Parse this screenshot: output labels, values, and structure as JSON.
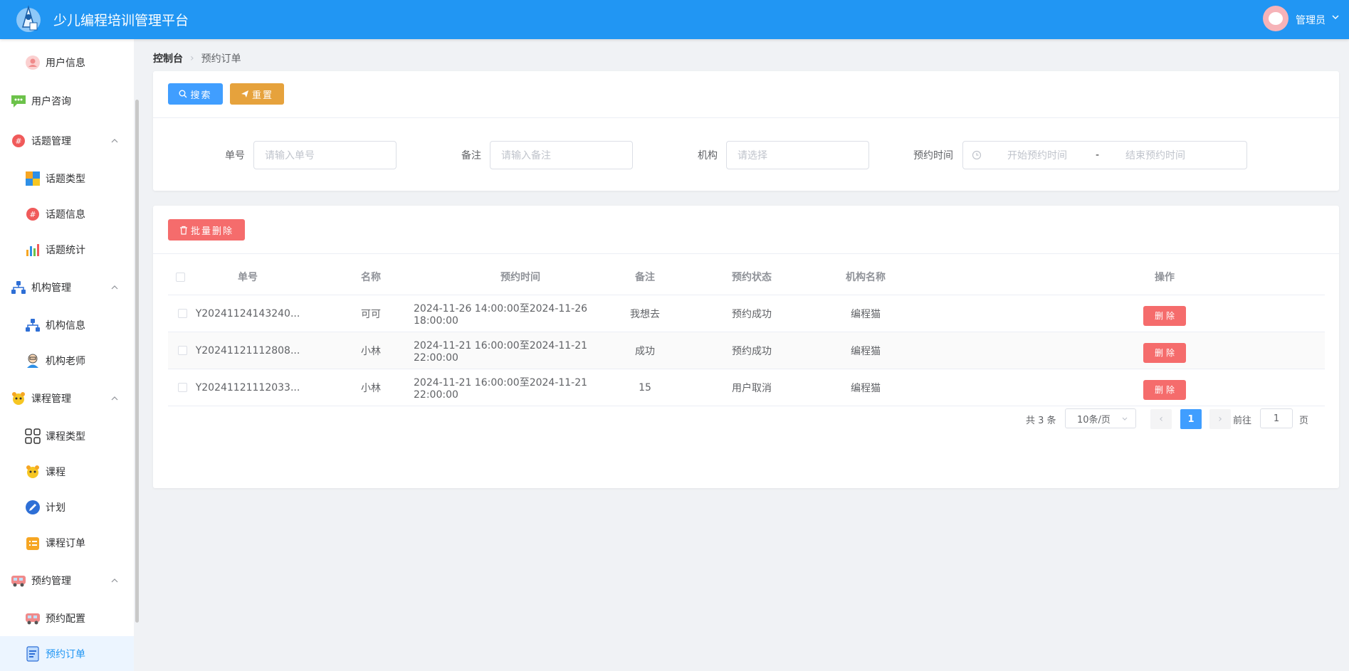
{
  "header": {
    "title": "少儿编程培训管理平台",
    "user": "管理员",
    "brand_color": "#2196f3"
  },
  "sidebar": {
    "items": [
      {
        "label": "用户信息",
        "icon": "user-icon",
        "level": "sub"
      },
      {
        "label": "用户咨询",
        "icon": "chat-icon",
        "level": "top"
      },
      {
        "label": "话题管理",
        "icon": "hashtag-icon",
        "level": "top",
        "expanded": true
      },
      {
        "label": "话题类型",
        "icon": "blocks-icon",
        "level": "sub"
      },
      {
        "label": "话题信息",
        "icon": "hashtag-icon",
        "level": "sub"
      },
      {
        "label": "话题统计",
        "icon": "bar-chart-icon",
        "level": "sub"
      },
      {
        "label": "机构管理",
        "icon": "org-icon",
        "level": "top",
        "expanded": true
      },
      {
        "label": "机构信息",
        "icon": "org-icon",
        "level": "sub"
      },
      {
        "label": "机构老师",
        "icon": "teacher-icon",
        "level": "sub"
      },
      {
        "label": "课程管理",
        "icon": "mascot-icon",
        "level": "top",
        "expanded": true
      },
      {
        "label": "课程类型",
        "icon": "grid-icon",
        "level": "sub"
      },
      {
        "label": "课程",
        "icon": "mascot-icon",
        "level": "sub"
      },
      {
        "label": "计划",
        "icon": "pencil-icon",
        "level": "sub"
      },
      {
        "label": "课程订单",
        "icon": "order-icon",
        "level": "sub"
      },
      {
        "label": "预约管理",
        "icon": "bus-icon",
        "level": "top",
        "expanded": true
      },
      {
        "label": "预约配置",
        "icon": "bus-icon",
        "level": "sub"
      },
      {
        "label": "预约订单",
        "icon": "document-icon",
        "level": "sub",
        "active": true
      }
    ]
  },
  "breadcrumb": {
    "home": "控制台",
    "current": "预约订单"
  },
  "toolbar": {
    "search": "搜索",
    "reset": "重置",
    "batch_delete": "批量删除"
  },
  "filters": {
    "order_no": {
      "label": "单号",
      "placeholder": "请输入单号"
    },
    "remark": {
      "label": "备注",
      "placeholder": "请输入备注"
    },
    "org": {
      "label": "机构",
      "placeholder": "请选择"
    },
    "time": {
      "label": "预约时间",
      "start_placeholder": "开始预约时间",
      "separator": "-",
      "end_placeholder": "结束预约时间"
    }
  },
  "table": {
    "columns": [
      "单号",
      "名称",
      "预约时间",
      "备注",
      "预约状态",
      "机构名称",
      "操作"
    ],
    "rows": [
      {
        "order_no": "Y20241124143240...",
        "name": "可可",
        "time": "2024-11-26 14:00:00至2024-11-26 18:00:00",
        "remark": "我想去",
        "status": "预约成功",
        "org": "编程猫",
        "action": "删除"
      },
      {
        "order_no": "Y20241121112808...",
        "name": "小林",
        "time": "2024-11-21 16:00:00至2024-11-21 22:00:00",
        "remark": "成功",
        "status": "预约成功",
        "org": "编程猫",
        "action": "删除"
      },
      {
        "order_no": "Y20241121112033...",
        "name": "小林",
        "time": "2024-11-21 16:00:00至2024-11-21 22:00:00",
        "remark": "15",
        "status": "用户取消",
        "org": "编程猫",
        "action": "删除"
      }
    ]
  },
  "pagination": {
    "total_text": "共 3 条",
    "page_size": "10条/页",
    "current_page": "1",
    "goto_prefix": "前往",
    "goto_value": "1",
    "goto_suffix": "页"
  }
}
